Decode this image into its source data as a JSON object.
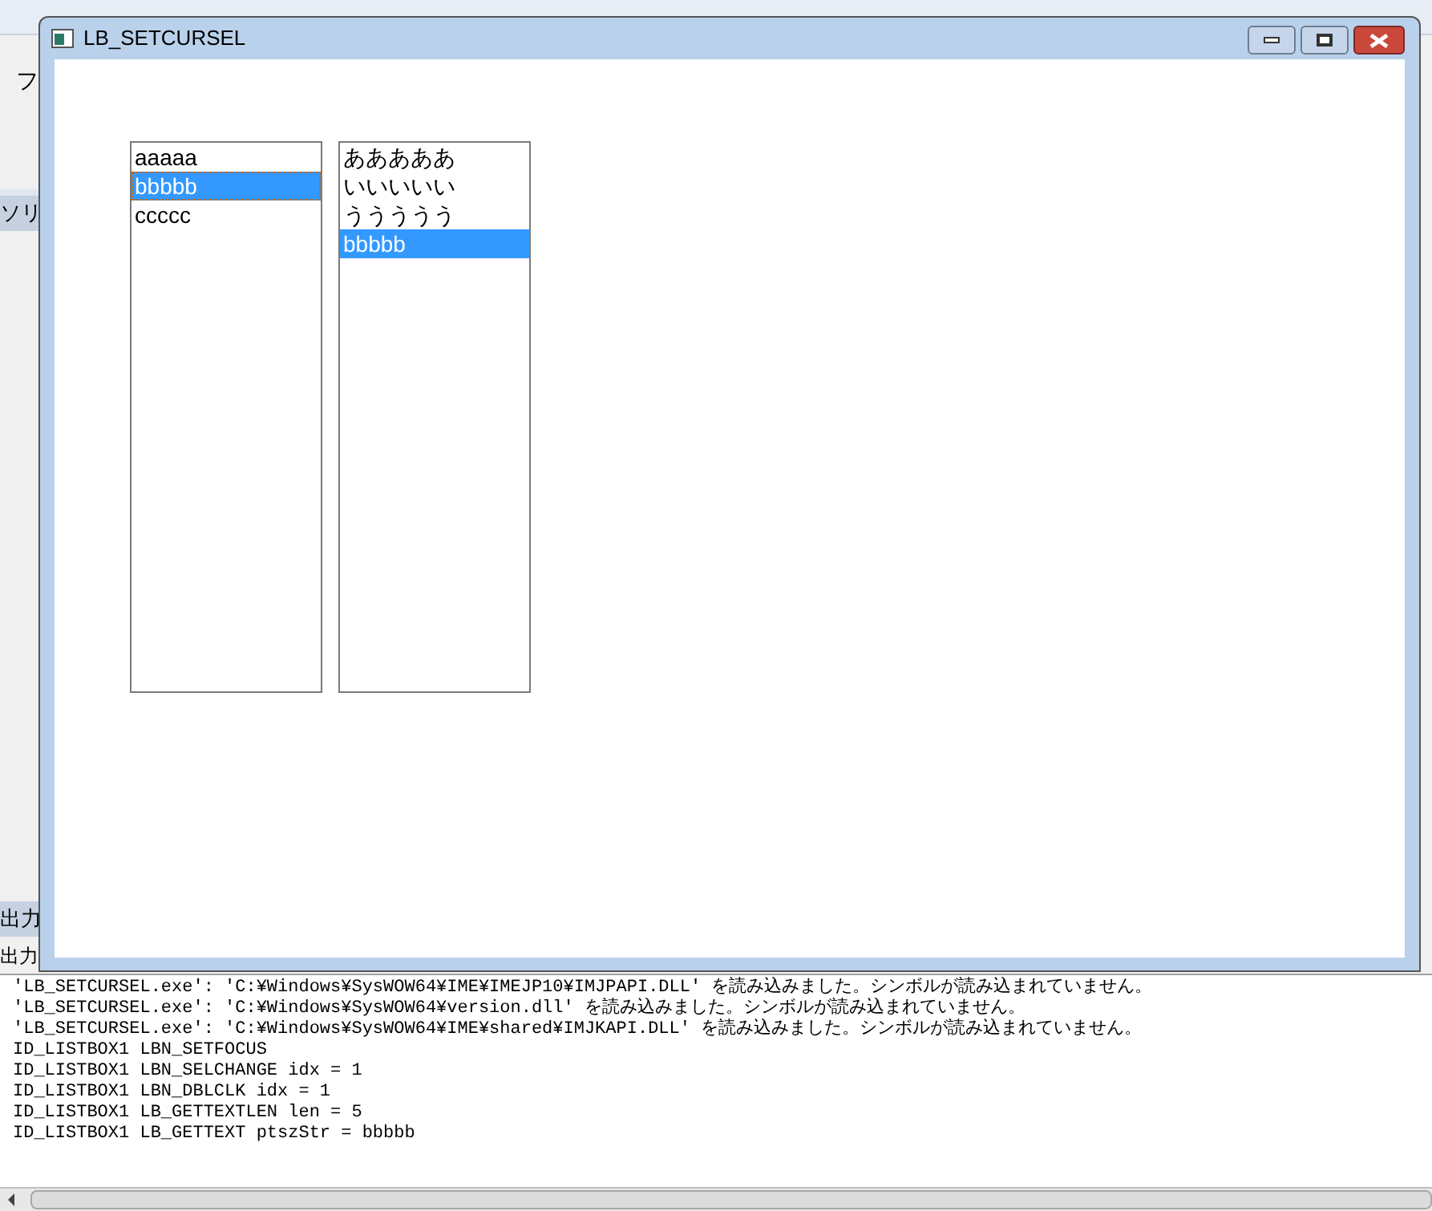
{
  "ide": {
    "menu_fragment": "フ",
    "panel_tab": "ソリ",
    "output_tab": "出力",
    "output_header": "出力"
  },
  "window": {
    "title": "LB_SETCURSEL"
  },
  "listboxes": [
    {
      "items": [
        {
          "text": "aaaaa",
          "selected": false,
          "focused": false
        },
        {
          "text": "bbbbb",
          "selected": true,
          "focused": true
        },
        {
          "text": "ccccc",
          "selected": false,
          "focused": false
        }
      ]
    },
    {
      "items": [
        {
          "text": "あああああ",
          "selected": false,
          "focused": false
        },
        {
          "text": "いいいいい",
          "selected": false,
          "focused": false
        },
        {
          "text": "ううううう",
          "selected": false,
          "focused": false
        },
        {
          "text": "bbbbb",
          "selected": true,
          "focused": false
        }
      ]
    }
  ],
  "output": {
    "lines": [
      "'LB_SETCURSEL.exe': 'C:¥Windows¥SysWOW64¥IME¥IMEJP10¥IMJPAPI.DLL' を読み込みました。シンボルが読み込まれていません。",
      "'LB_SETCURSEL.exe': 'C:¥Windows¥SysWOW64¥version.dll' を読み込みました。シンボルが読み込まれていません。",
      "'LB_SETCURSEL.exe': 'C:¥Windows¥SysWOW64¥IME¥shared¥IMJKAPI.DLL' を読み込みました。シンボルが読み込まれていません。",
      "ID_LISTBOX1 LBN_SETFOCUS",
      "ID_LISTBOX1 LBN_SELCHANGE idx = 1",
      "ID_LISTBOX1 LBN_DBLCLK idx = 1",
      "ID_LISTBOX1 LB_GETTEXTLEN len = 5",
      "ID_LISTBOX1 LB_GETTEXT ptszStr = bbbbb"
    ]
  }
}
